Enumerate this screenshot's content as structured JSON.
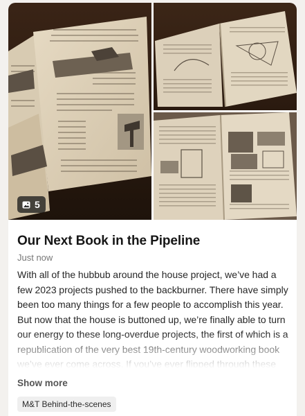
{
  "post": {
    "title": "Our Next Book in the Pipeline",
    "timestamp": "Just now",
    "body": "With all of the hubbub around the house project, we’ve had a few 2023 projects pushed to the backburner. There have simply been too many things for a few people to accomplish this year. But now that the house is buttoned up, we’re finally able to turn our energy to these long-overdue projects, the first of which is a republication of the very best 19th-century woodworking book we’ve ever come across. If you’ve ever flipped through these texts, you know you see a lot of repetition, creative “borrowing,” and what would today be",
    "show_more_label": "Show more",
    "tag": "M&T Behind-the-scenes"
  },
  "gallery": {
    "photo_count": "5",
    "count_icon": "image-icon",
    "photos": [
      {
        "name": "open-book-plane-illustration"
      },
      {
        "name": "open-book-geometry-diagrams"
      },
      {
        "name": "open-book-joinery-illustrations"
      }
    ]
  },
  "colors": {
    "page_background": "#f3f1ee",
    "card_background": "#ffffff",
    "muted_text": "#777777",
    "tag_background": "#efefef"
  }
}
